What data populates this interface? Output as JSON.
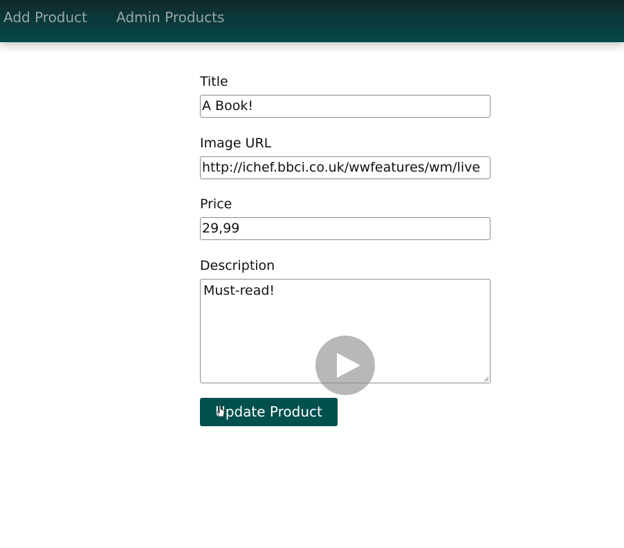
{
  "nav": {
    "items": [
      {
        "label": "Add Product"
      },
      {
        "label": "Admin Products"
      }
    ]
  },
  "form": {
    "title_label": "Title",
    "title_value": "A Book!",
    "image_label": "Image URL",
    "image_value": "http://ichef.bbci.co.uk/wwfeatures/wm/live",
    "price_label": "Price",
    "price_value": "29,99",
    "description_label": "Description",
    "description_value": "Must-read!",
    "submit_label": "Update Product"
  },
  "overlay": {
    "icon": "play-icon"
  },
  "colors": {
    "header": "#0a3b3c",
    "nav_text": "#9aa6a6",
    "button": "#00504e"
  }
}
